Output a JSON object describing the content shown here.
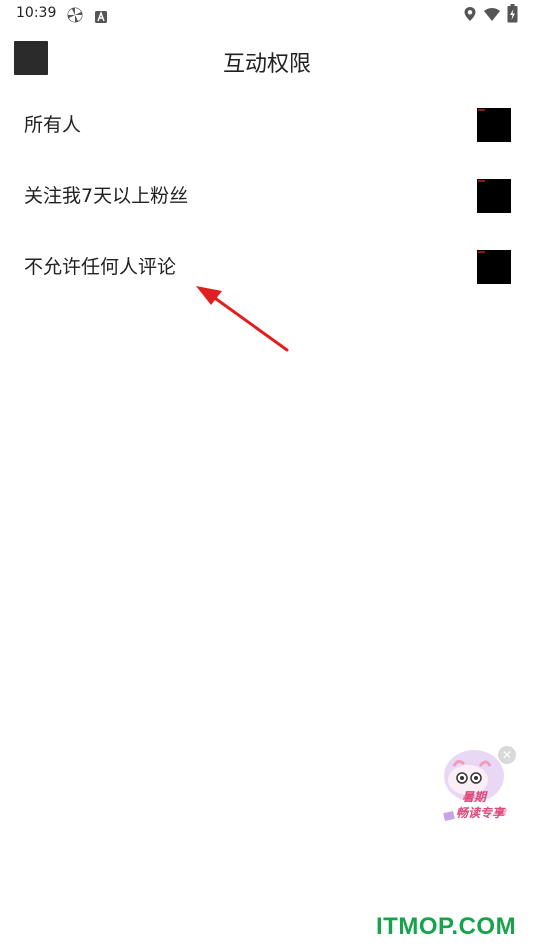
{
  "status_bar": {
    "time": "10:39",
    "icons": [
      "pinwheel-icon",
      "a-badge-icon",
      "location-icon",
      "wifi-icon",
      "battery-icon"
    ]
  },
  "header": {
    "title": "互动权限",
    "back_icon": "back-icon"
  },
  "options": [
    {
      "label": "所有人"
    },
    {
      "label": "关注我7天以上粉丝"
    },
    {
      "label": "不允许任何人评论"
    }
  ],
  "annotation": {
    "arrow_color": "#e02020"
  },
  "promo": {
    "line1": "暑期",
    "line2": "畅读专享"
  },
  "watermark": "ITMOP.COM",
  "colors": {
    "watermark": "#16a34a",
    "promo_text": "#e04a7a"
  }
}
